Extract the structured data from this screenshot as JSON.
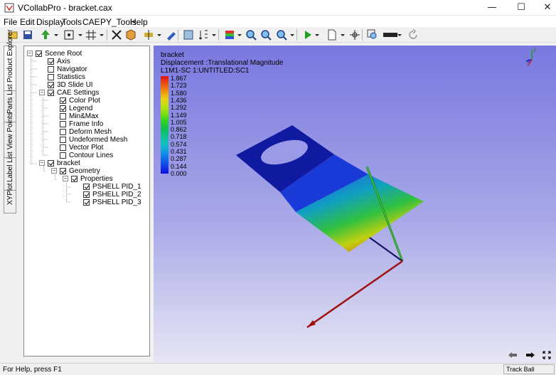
{
  "window": {
    "title": "VCollabPro - bracket.cax",
    "minimize": "—",
    "maximize": "☐",
    "close": "✕"
  },
  "menu": [
    "File",
    "Edit",
    "Display",
    "Tools",
    "CAE",
    "PY_Tools",
    "Help"
  ],
  "side_tabs": [
    "Product Explorer",
    "Parts List",
    "View Points",
    "Label List",
    "XYPlot"
  ],
  "tree": [
    {
      "label": "Scene Root",
      "checked": true,
      "expander": "minus",
      "level": 0
    },
    {
      "label": "Axis",
      "checked": true,
      "level": 1
    },
    {
      "label": "Navigator",
      "checked": false,
      "level": 1
    },
    {
      "label": "Statistics",
      "checked": false,
      "level": 1
    },
    {
      "label": "3D Slide UI",
      "checked": true,
      "level": 1
    },
    {
      "label": "CAE Settings",
      "checked": true,
      "expander": "minus",
      "level": 1
    },
    {
      "label": "Color Plot",
      "checked": true,
      "level": 2
    },
    {
      "label": "Legend",
      "checked": true,
      "level": 2
    },
    {
      "label": "Min&Max",
      "checked": false,
      "level": 2
    },
    {
      "label": "Frame Info",
      "checked": false,
      "level": 2
    },
    {
      "label": "Deform Mesh",
      "checked": false,
      "level": 2
    },
    {
      "label": "Undeformed Mesh",
      "checked": false,
      "level": 2
    },
    {
      "label": "Vector Plot",
      "checked": false,
      "level": 2
    },
    {
      "label": "Contour Lines",
      "checked": false,
      "level": 2
    },
    {
      "label": "bracket",
      "checked": true,
      "expander": "minus",
      "level": 1
    },
    {
      "label": "Geometry",
      "checked": true,
      "expander": "minus",
      "level": 2
    },
    {
      "label": "Properties",
      "checked": true,
      "expander": "minus",
      "level": 3
    },
    {
      "label": "PSHELL PID_1",
      "checked": true,
      "level": 4
    },
    {
      "label": "PSHELL PID_2",
      "checked": true,
      "level": 4
    },
    {
      "label": "PSHELL PID_3",
      "checked": true,
      "level": 4
    }
  ],
  "viewport": {
    "model_name": "bracket",
    "result": "Displacement :Translational Magnitude",
    "step": "L1M1-SC 1:UNTITLED:SC1",
    "legend_values": [
      "1.867",
      "1.723",
      "1.580",
      "1.436",
      "1.292",
      "1.149",
      "1.005",
      "0.862",
      "0.718",
      "0.574",
      "0.431",
      "0.287",
      "0.144",
      "0.000"
    ],
    "legend_colors": [
      "#e01010",
      "#e85010",
      "#f09010",
      "#e8d010",
      "#c0e010",
      "#80e010",
      "#30d020",
      "#10c050",
      "#10c090",
      "#10c0c0",
      "#10a0e0",
      "#1070e8",
      "#1040e8",
      "#1010e0"
    ],
    "triad_labels": [
      "y",
      "z",
      "x"
    ],
    "nav_icons": [
      "prev-icon",
      "next-icon",
      "fullscreen-icon"
    ]
  },
  "status": {
    "help": "For Help, press F1",
    "mode": "Track Ball"
  }
}
